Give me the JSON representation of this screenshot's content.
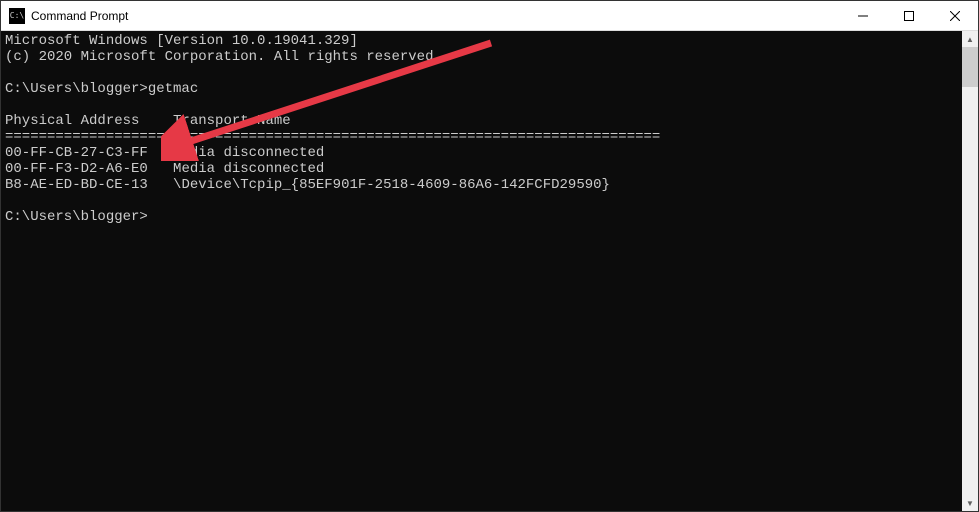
{
  "window": {
    "title": "Command Prompt",
    "icon_glyph": "C:\\"
  },
  "terminal": {
    "header1": "Microsoft Windows [Version 10.0.19041.329]",
    "header2": "(c) 2020 Microsoft Corporation. All rights reserved.",
    "prompt1_prefix": "C:\\Users\\blogger>",
    "prompt1_command": "getmac",
    "col_header1": "Physical Address",
    "col_header2": "Transport Name",
    "divider": "=================== ==========================================================",
    "rows": [
      {
        "mac": "00-FF-CB-27-C3-FF",
        "transport": "Media disconnected"
      },
      {
        "mac": "00-FF-F3-D2-A6-E0",
        "transport": "Media disconnected"
      },
      {
        "mac": "B8-AE-ED-BD-CE-13",
        "transport": "\\Device\\Tcpip_{85EF901F-2518-4609-86A6-142FCFD29590}"
      }
    ],
    "prompt2_prefix": "C:\\Users\\blogger>"
  },
  "annotation": {
    "arrow_color": "#e63946"
  }
}
